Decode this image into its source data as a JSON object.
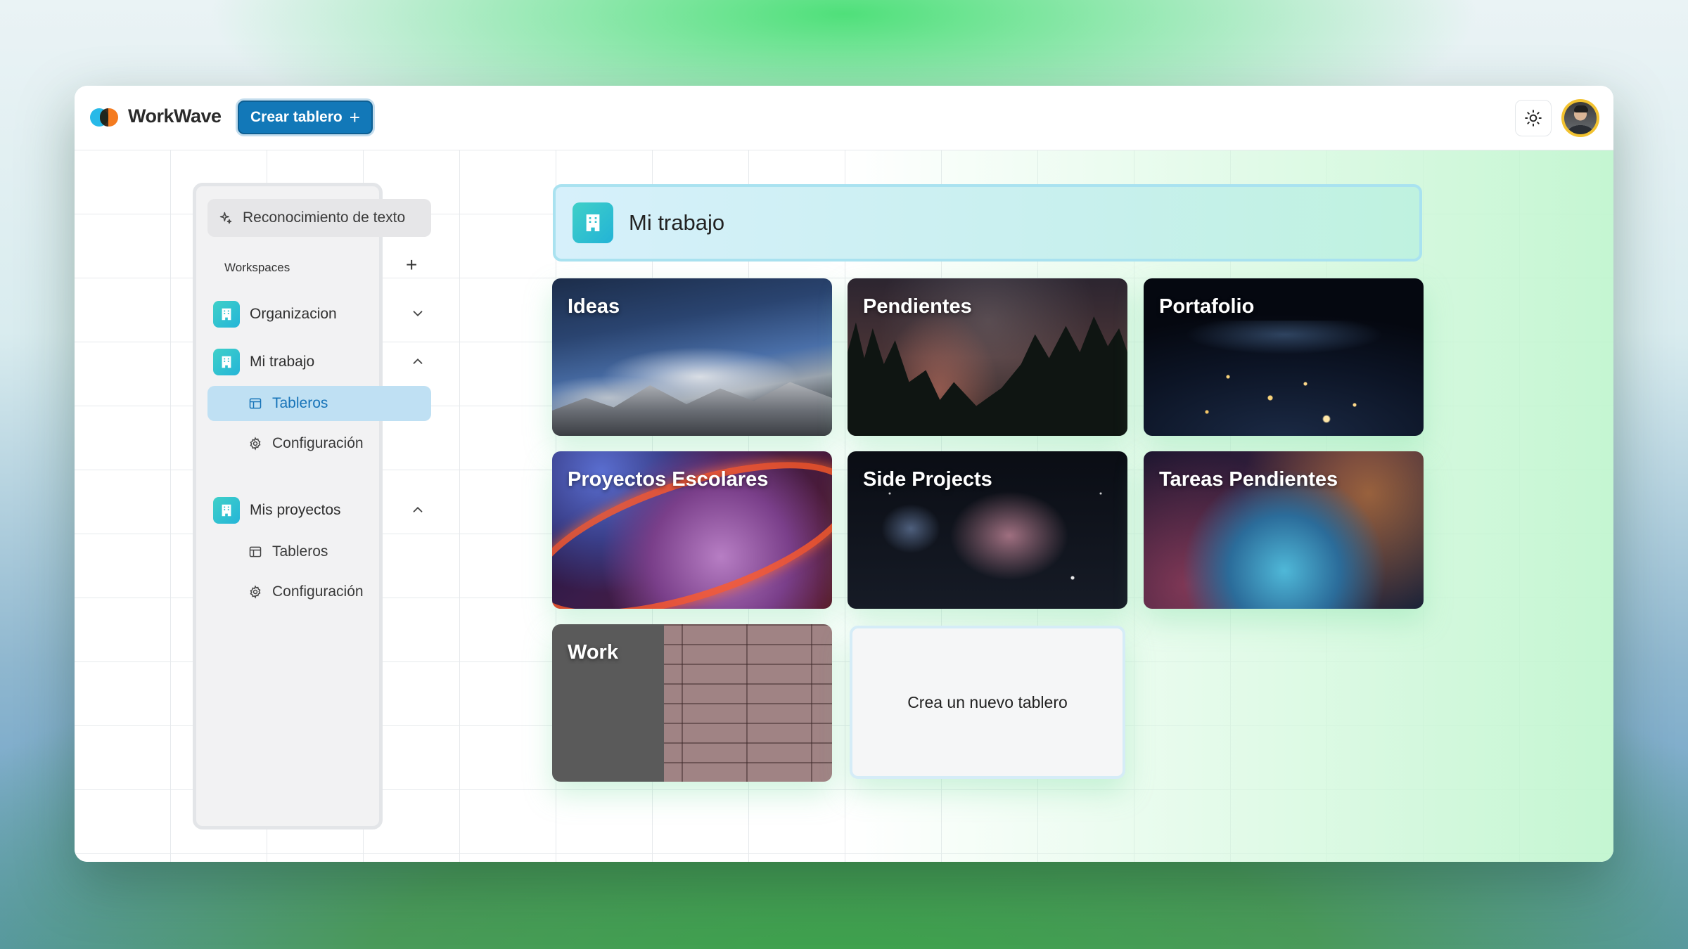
{
  "app": {
    "brand": "WorkWave",
    "create_board_label": "Crear tablero",
    "create_board_plus": "+"
  },
  "sidebar": {
    "ocr_label": "Reconocimiento de texto",
    "workspaces_label": "Workspaces",
    "workspaces_add": "+",
    "groups": [
      {
        "name": "Organizacion",
        "expanded": false
      },
      {
        "name": "Mi trabajo",
        "expanded": true,
        "items": [
          {
            "label": "Tableros",
            "active": true
          },
          {
            "label": "Configuración",
            "active": false
          }
        ]
      },
      {
        "name": "Mis proyectos",
        "expanded": true,
        "items": [
          {
            "label": "Tableros",
            "active": false
          },
          {
            "label": "Configuración",
            "active": false
          }
        ]
      }
    ]
  },
  "main": {
    "title": "Mi trabajo",
    "boards": [
      {
        "title": "Ideas"
      },
      {
        "title": "Pendientes"
      },
      {
        "title": "Portafolio"
      },
      {
        "title": "Proyectos Escolares"
      },
      {
        "title": "Side Projects"
      },
      {
        "title": "Tareas Pendientes"
      },
      {
        "title": "Work"
      }
    ],
    "new_board_label": "Crea un nuevo tablero"
  },
  "colors": {
    "accent": "#1278b8",
    "workspace_icon": "#2fc3d0",
    "active_item_bg": "#bfe0f3"
  },
  "icons": {
    "theme_toggle": "sun-icon",
    "ocr": "sparkles-icon",
    "workspace": "building-icon",
    "boards": "table-icon",
    "settings": "gear-icon"
  }
}
